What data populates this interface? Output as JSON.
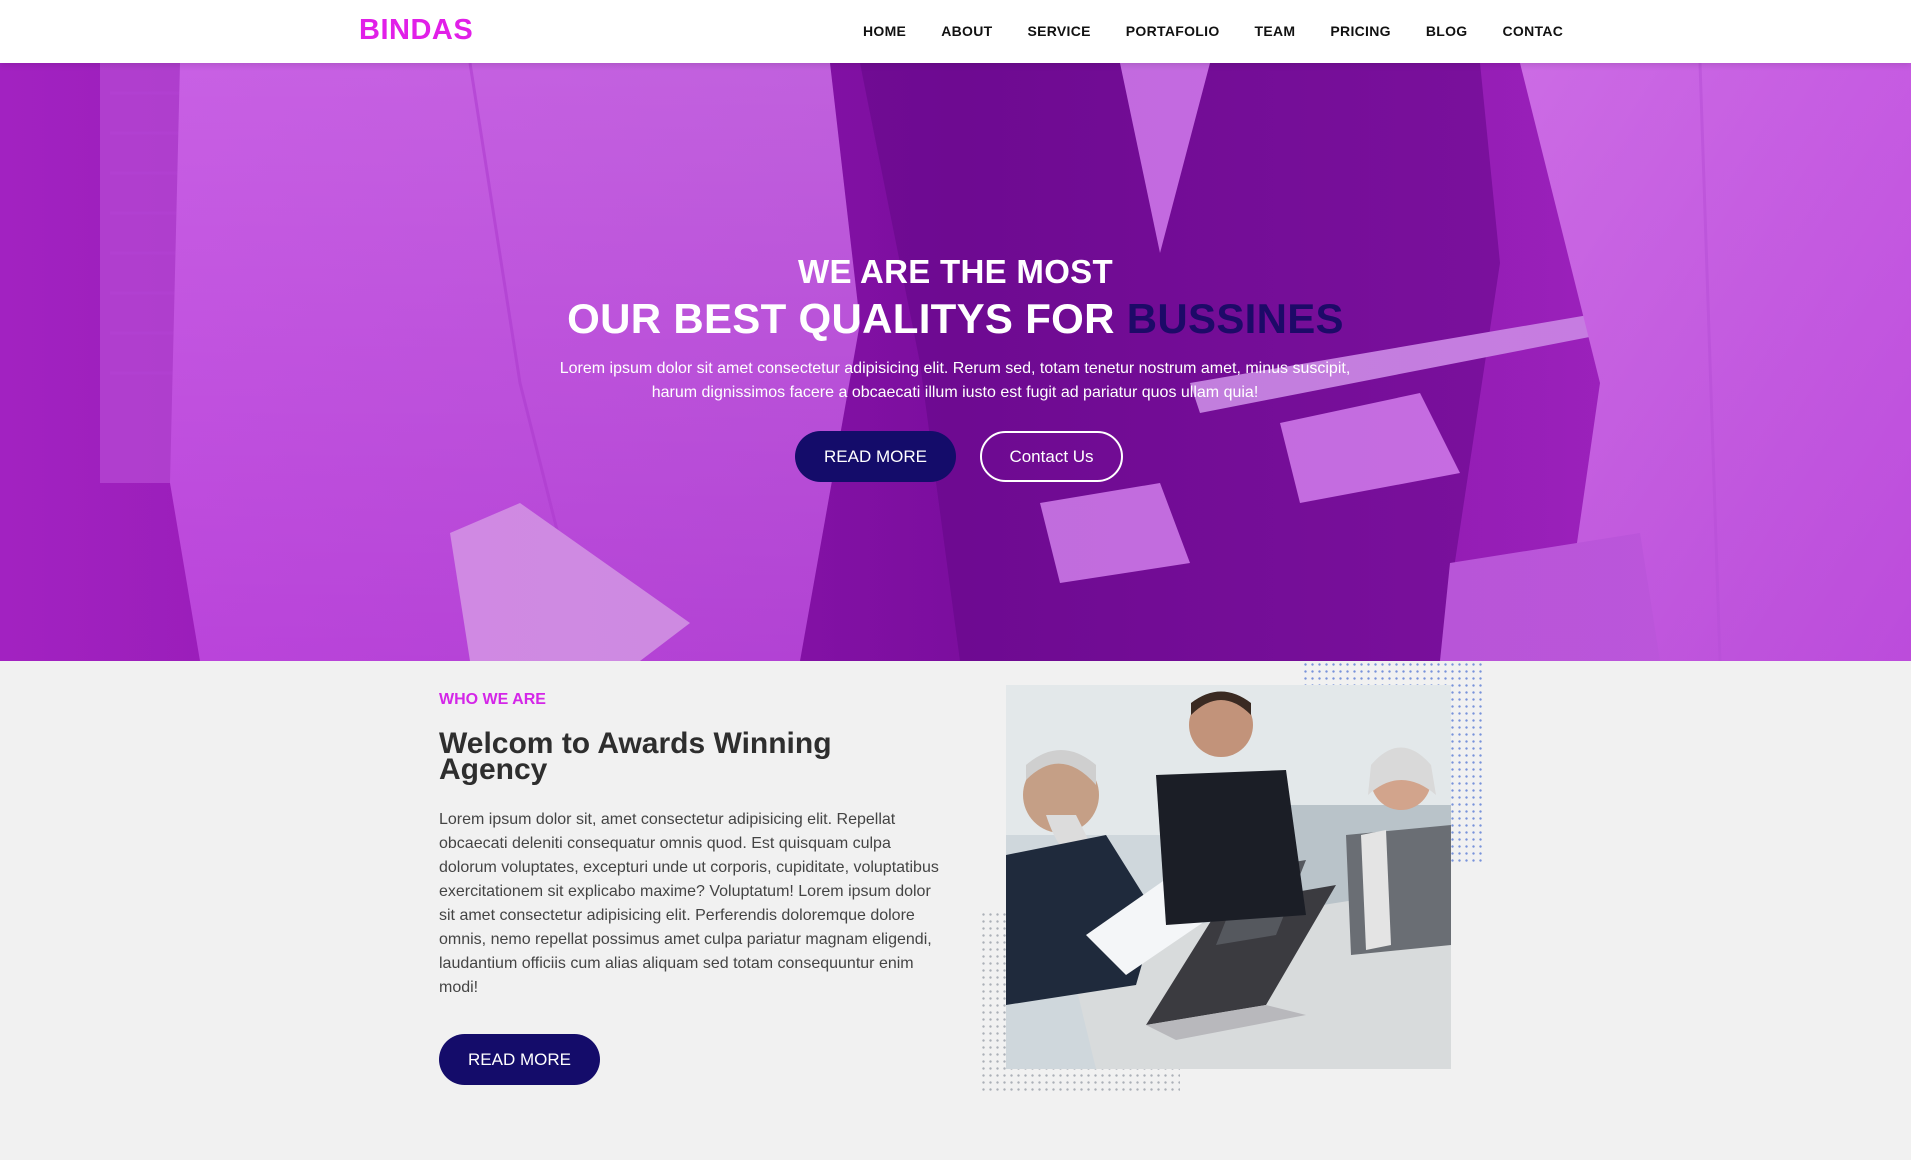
{
  "brand": {
    "name": "BINDAS",
    "color": "#e11fe8"
  },
  "nav": {
    "items": [
      "HOME",
      "ABOUT",
      "SERVICE",
      "PORTAFOLIO",
      "TEAM",
      "PRICING",
      "BLOG",
      "CONTAC"
    ]
  },
  "hero": {
    "kicker": "WE ARE THE MOST",
    "title_main": "OUR BEST QUALITYS FOR ",
    "title_highlight": "BUSSINES",
    "text_line1": "Lorem ipsum dolor sit amet consectetur adipisicing elit. Rerum sed, totam tenetur nostrum amet, minus suscipit,",
    "text_line2": "harum dignissimos facere a obcaecati illum iusto est fugit ad pariatur quos ullam quia!",
    "read_more_label": "READ MORE",
    "contact_label": "Contact Us"
  },
  "about": {
    "eyebrow": "WHO WE ARE",
    "title": "Welcom to Awards Winning Agency",
    "text": "Lorem ipsum dolor sit, amet consectetur adipisicing elit. Repellat obcaecati deleniti consequatur omnis quod. Est quisquam culpa dolorum voluptates, excepturi unde ut corporis, cupiditate, voluptatibus exercitationem sit explicabo maxime? Voluptatum! Lorem ipsum dolor sit amet consectetur adipisicing elit. Perferendis doloremque dolore omnis, nemo repellat possimus amet culpa pariatur magnam eligendi, laudantium officiis cum alias aliquam sed totam consequuntur enim modi!",
    "read_more_label": "READ MORE"
  },
  "colors": {
    "accent_purple": "#d426e8",
    "button_navy": "#140c6a",
    "hero_overlay": "#b228d2"
  }
}
